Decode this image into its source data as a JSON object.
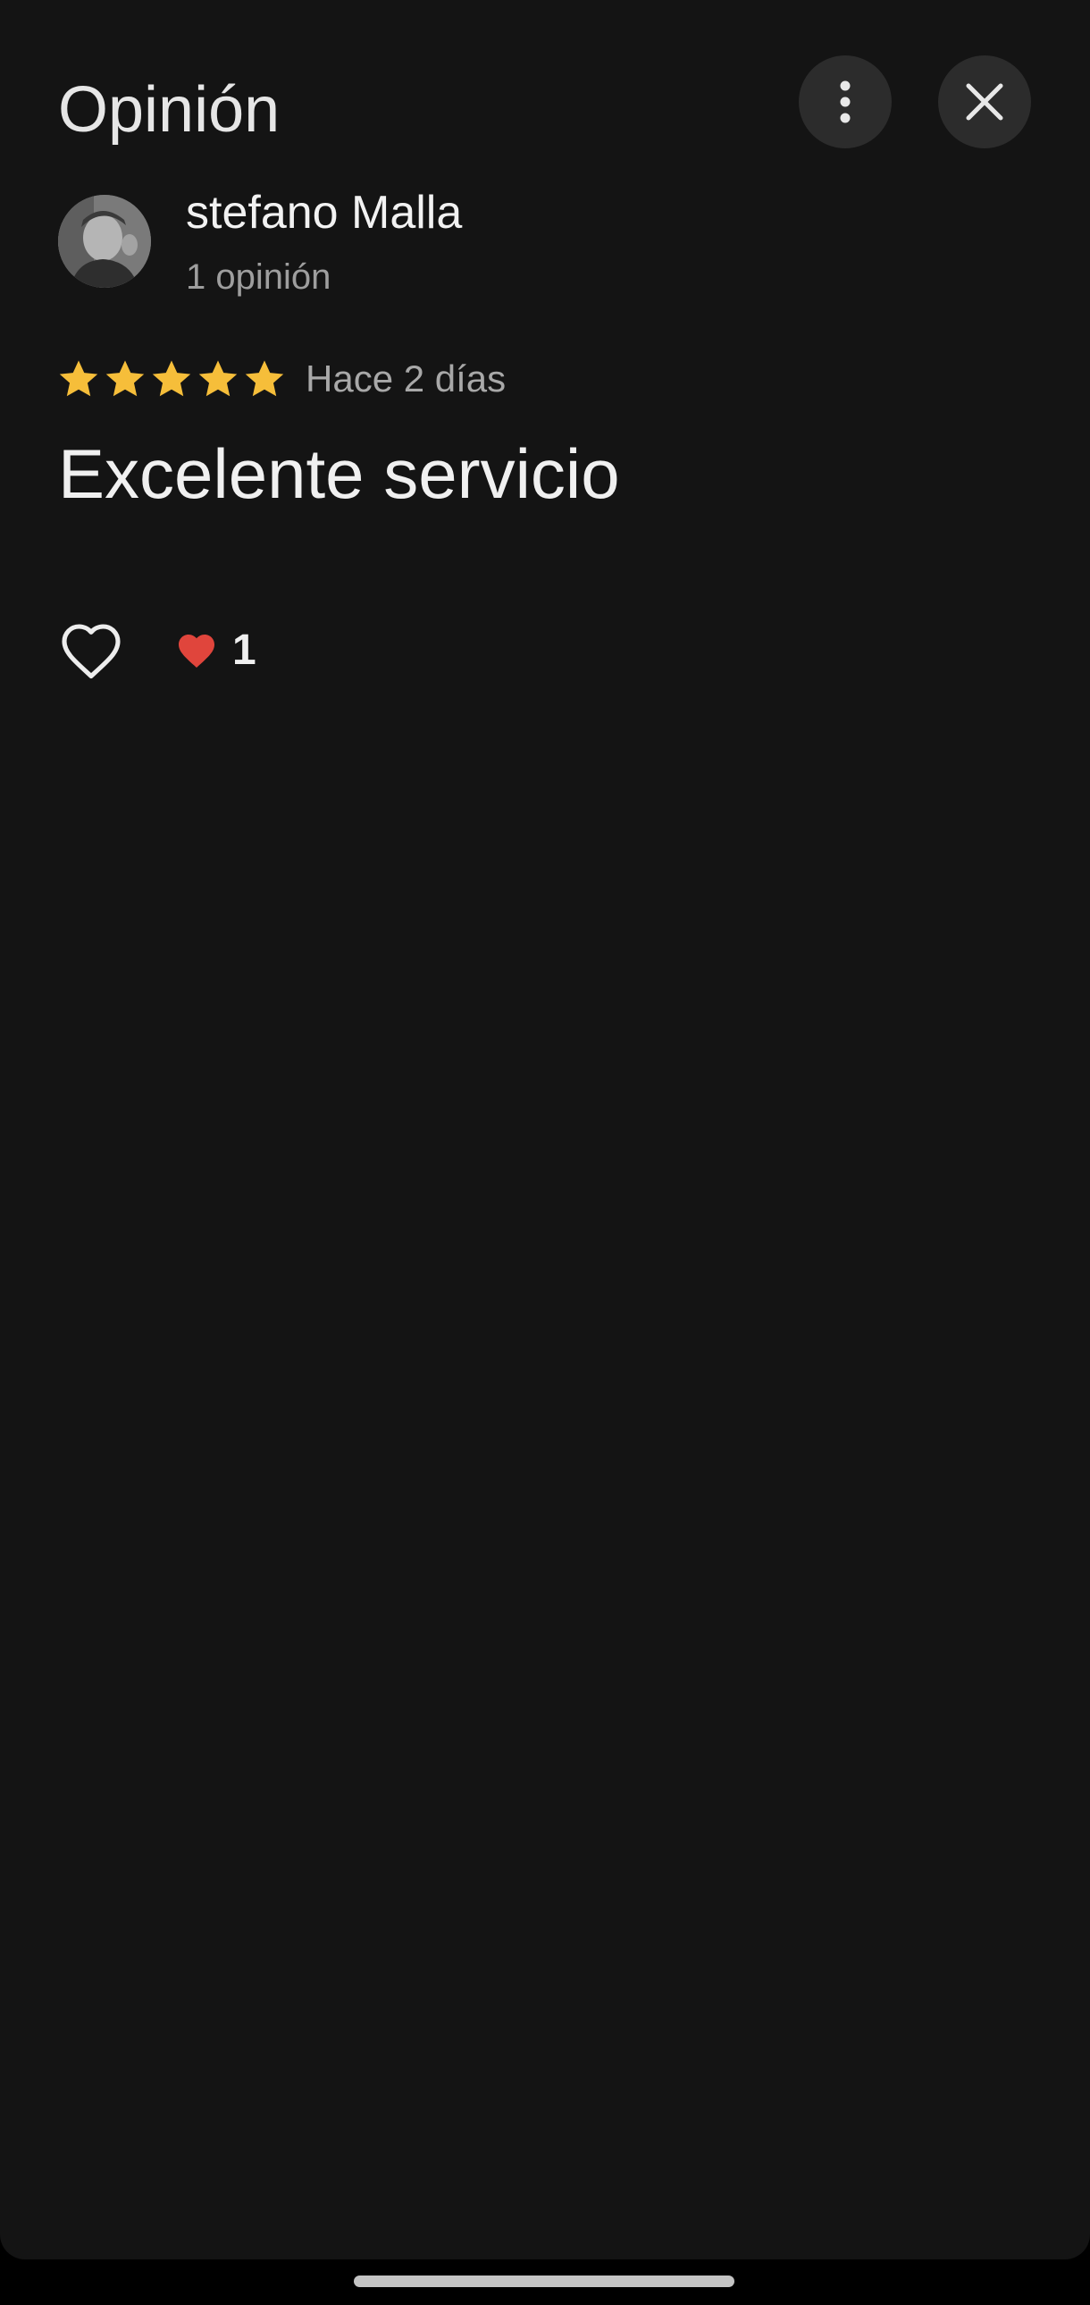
{
  "header": {
    "title": "Opinión",
    "more_icon": "more-vert-icon",
    "close_icon": "close-icon"
  },
  "author": {
    "name": "stefano Malla",
    "review_count": "1 opinión"
  },
  "review": {
    "rating": 5,
    "rating_max": 5,
    "date": "Hace 2 días",
    "text": "Excelente servicio"
  },
  "reactions": {
    "like_icon": "heart-outline-icon",
    "reaction_icon": "red-heart-icon",
    "count": "1"
  },
  "colors": {
    "background": "#141414",
    "star": "#f6be3a",
    "heart": "#e0453c"
  }
}
